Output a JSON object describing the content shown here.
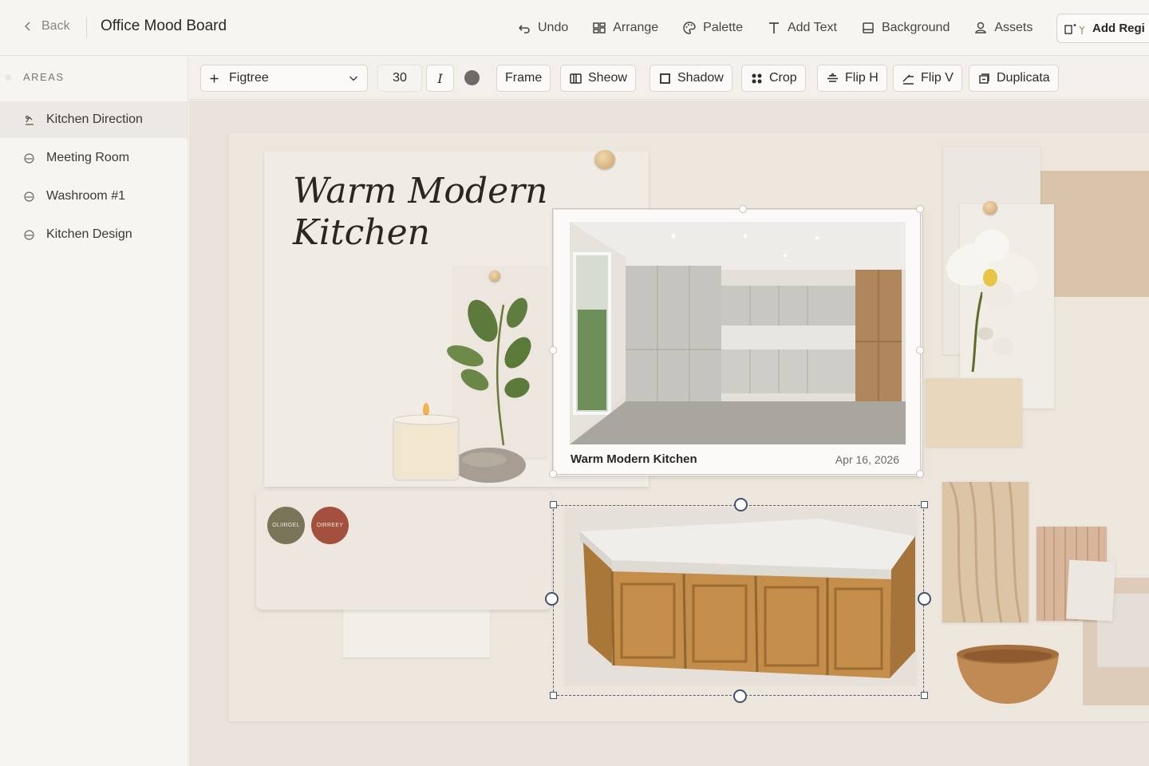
{
  "topbar": {
    "back_label": "Back",
    "board_title": "Office Mood Board",
    "actions": [
      {
        "label": "Undo",
        "icon": "undo-icon"
      },
      {
        "label": "Arrange",
        "icon": "arrange-icon"
      },
      {
        "label": "Palette",
        "icon": "palette-icon"
      },
      {
        "label": "Add Text",
        "icon": "text-icon"
      },
      {
        "label": "Background",
        "icon": "background-icon"
      },
      {
        "label": "Assets",
        "icon": "assets-icon"
      }
    ],
    "add_region_label": "Add Regi"
  },
  "sidebar": {
    "title": "AREAS",
    "items": [
      {
        "label": "Kitchen Direction",
        "icon": "kitchen-icon",
        "active": true
      },
      {
        "label": "Meeting Room",
        "icon": "area-icon",
        "active": false
      },
      {
        "label": "Washroom #1",
        "icon": "area-icon",
        "active": false
      },
      {
        "label": "Kitchen Design",
        "icon": "area-icon",
        "active": false
      }
    ]
  },
  "toolbar": {
    "font_family": "Figtree",
    "font_size": "30",
    "italic_label": "I",
    "color": "#6e6b67",
    "frame_label": "Frame",
    "sheow_label": "Sheow",
    "shadow_label": "Shadow",
    "crop_label": "Crop",
    "fliph_label": "Flip H",
    "flipv_label": "Flip V",
    "duplicate_label": "Duplicata"
  },
  "board": {
    "heading_line1": "Warm Modern",
    "heading_line2": "Kitchen",
    "photo_caption": "Warm Modern Kitchen",
    "photo_date": "Apr 16, 2026",
    "swatches": [
      {
        "label": "OLIIRGEL",
        "color": "#7a7558"
      },
      {
        "label": "OIRREEY",
        "color": "#a3503e"
      }
    ]
  },
  "colors": {
    "accent_selection": "#43536b",
    "canvas_bg": "#e9e3dc",
    "sidebar_active": "#ece9e4"
  }
}
